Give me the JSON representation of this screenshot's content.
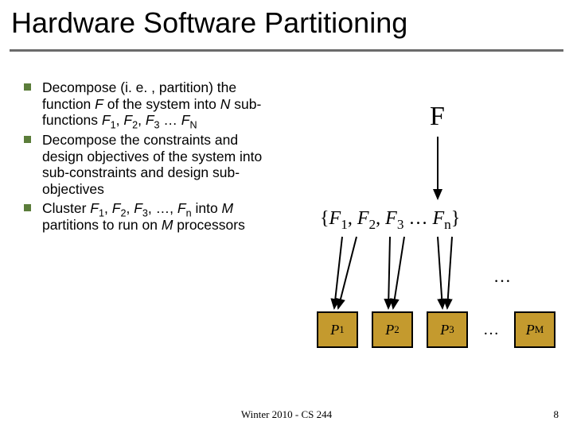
{
  "title": "Hardware Software Partitioning",
  "bullets": [
    {
      "html": "Decompose (i. e. , partition) the function <span class='ital'>F</span> of the system into <span class='ital'>N</span> sub-functions <span class='ital'>F</span><span class='sub'>1</span>, <span class='ital'>F</span><span class='sub'>2</span>, <span class='ital'>F</span><span class='sub'>3</span> … <span class='ital'>F</span><span class='sub'>N</span>"
    },
    {
      "html": "Decompose the constraints and design objectives of the system into sub-constraints and design sub-objectives"
    },
    {
      "html": "Cluster <span class='ital'>F</span><span class='sub'>1</span>, <span class='ital'>F</span><span class='sub'>2</span>, <span class='ital'>F</span><span class='sub'>3</span>, …, <span class='ital'>F</span><span class='sub'>n</span> into <span class='ital'>M</span> partitions to run on <span class='ital'>M</span> processors"
    }
  ],
  "diagram": {
    "big_f": "F",
    "fset_html": "{<span class='ital'>F</span><span class='sub'>1</span>, <span class='ital'>F</span><span class='sub'>2</span>, <span class='ital'>F</span><span class='sub'>3</span> … <span class='ital'>F</span><span class='sub'>n</span>}",
    "mid_dots": "…",
    "proc_dots": "…",
    "procs": [
      {
        "html": "<span class='ital'>P</span><span class='sub'>1</span>"
      },
      {
        "html": "<span class='ital'>P</span><span class='sub'>2</span>"
      },
      {
        "html": "<span class='ital'>P</span><span class='sub'>3</span>"
      },
      {
        "html": "<span class='ital'>P</span><span class='sub'>M</span>"
      }
    ]
  },
  "footer": "Winter 2010 - CS 244",
  "page": "8"
}
